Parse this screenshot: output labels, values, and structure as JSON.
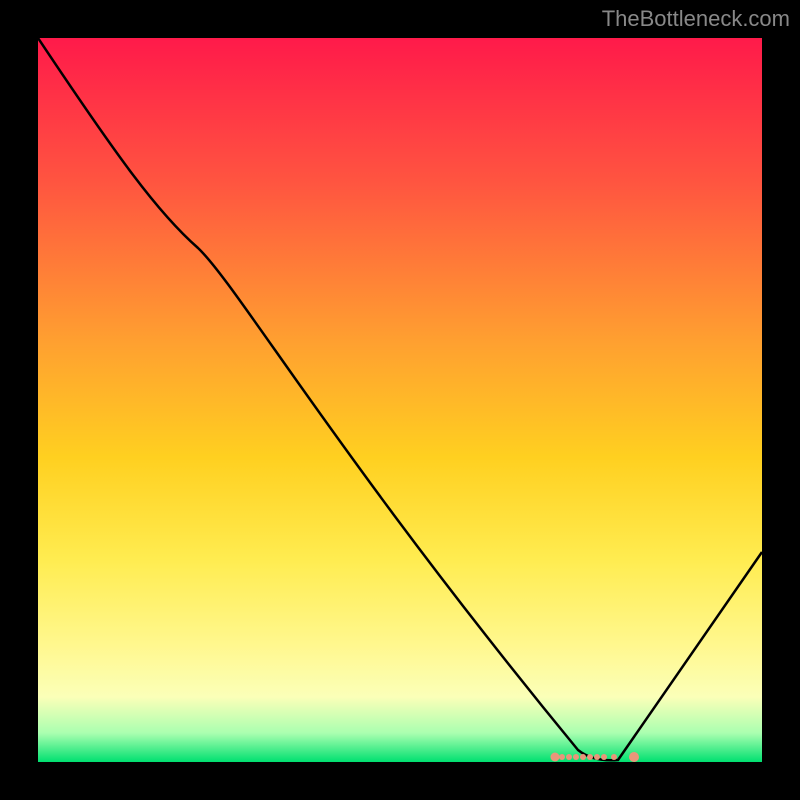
{
  "watermark": "TheBottleneck.com",
  "chart_data": {
    "type": "line",
    "title": "",
    "xlabel": "",
    "ylabel": "",
    "xlim": [
      0,
      100
    ],
    "ylim": [
      0,
      100
    ],
    "x": [
      0,
      22,
      75,
      80,
      100
    ],
    "values": [
      100,
      71,
      1,
      0,
      29
    ],
    "notch": {
      "x_range": [
        71,
        81
      ],
      "y": 0
    },
    "gradient_stops": [
      {
        "pos": 0,
        "color": "#ff1a4a"
      },
      {
        "pos": 20,
        "color": "#ff5540"
      },
      {
        "pos": 42,
        "color": "#ffa030"
      },
      {
        "pos": 58,
        "color": "#ffd020"
      },
      {
        "pos": 72,
        "color": "#ffec50"
      },
      {
        "pos": 84,
        "color": "#fff88f"
      },
      {
        "pos": 91,
        "color": "#fbffb8"
      },
      {
        "pos": 96,
        "color": "#aaffb0"
      },
      {
        "pos": 100,
        "color": "#00e070"
      }
    ]
  }
}
